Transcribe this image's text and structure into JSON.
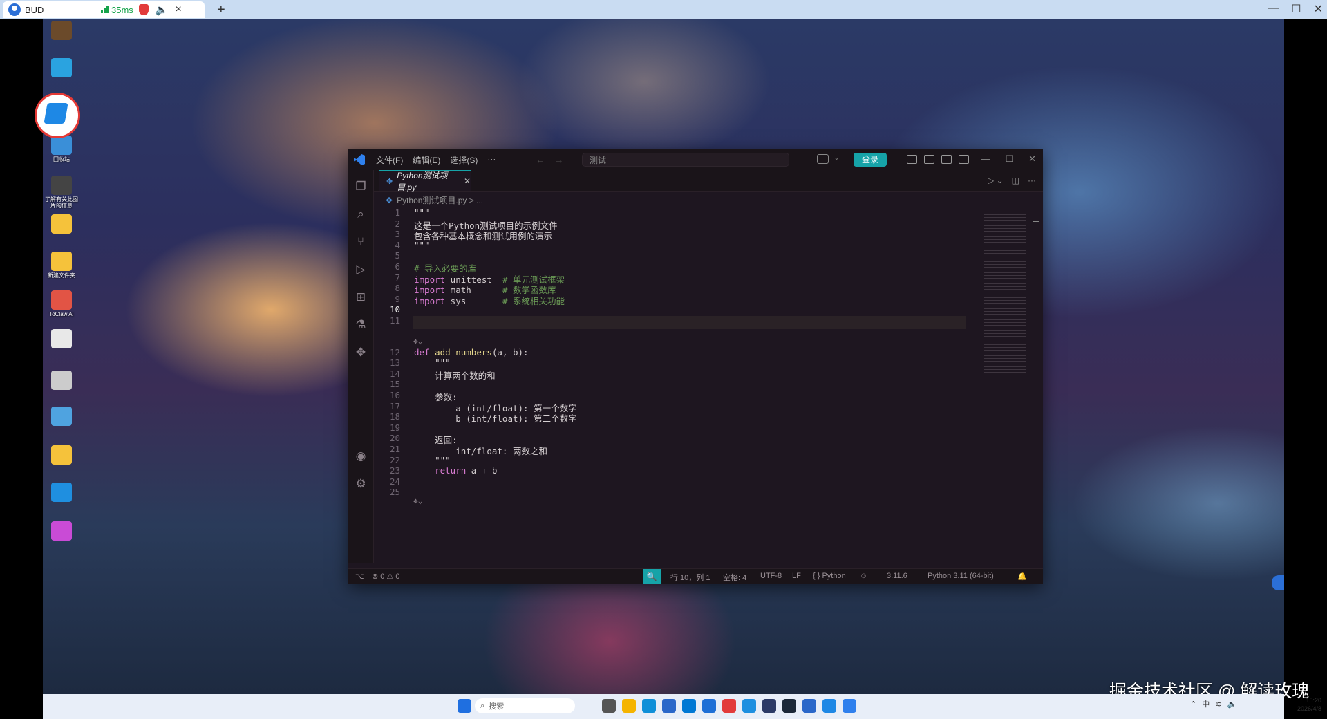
{
  "remote": {
    "tab_name": "BUD",
    "ping": "35ms",
    "close_glyph": "×",
    "new_tab_glyph": "+",
    "win_min": "—",
    "win_max": "☐",
    "win_close": "✕"
  },
  "desktop": {
    "icons": [
      {
        "label": "",
        "icon": "app-icon",
        "color": "#6b4a2a"
      },
      {
        "label": "",
        "icon": "window-icon",
        "color": "#2aa3e0"
      },
      {
        "label": "回收站",
        "icon": "recycle-bin-icon",
        "color": "#3a8fd8"
      },
      {
        "label": "了解有关此图片的信息",
        "icon": "info-icon",
        "color": "#444444"
      },
      {
        "label": "",
        "icon": "folder-icon",
        "color": "#f5c23b"
      },
      {
        "label": "新建文件夹",
        "icon": "folder-icon",
        "color": "#f5c23b"
      },
      {
        "label": "ToClaw AI",
        "icon": "crab-icon",
        "color": "#e25445"
      },
      {
        "label": "",
        "icon": "document-icon",
        "color": "#e8e8e8"
      },
      {
        "label": "",
        "icon": "laptop-icon",
        "color": "#cccccc"
      },
      {
        "label": "",
        "icon": "folder-icon",
        "color": "#4fa3e0"
      },
      {
        "label": "",
        "icon": "folder-icon",
        "color": "#f5c23b"
      },
      {
        "label": "",
        "icon": "edge-icon",
        "color": "#1f8fe0"
      },
      {
        "label": "",
        "icon": "app-icon",
        "color": "#c94bd6"
      }
    ],
    "watermark": "掘金技术社区 @ 解读玫瑰"
  },
  "taskbar": {
    "search_label": "搜索",
    "tray_ime": "中",
    "clock_time": "15:20",
    "clock_date": "2026/4/8",
    "app_colors": [
      "#1f6fe0",
      "#555555",
      "#f5b400",
      "#0f8fd8",
      "#2a67c9",
      "#0078d4",
      "#1e6fd6",
      "#e23b3b",
      "#1d8fe0",
      "#2b3a66",
      "#1b2838",
      "#2a67c9",
      "#1e88e5",
      "#2f80ed"
    ]
  },
  "vscode": {
    "menu": [
      "文件(F)",
      "编辑(E)",
      "选择(S)",
      "···"
    ],
    "nav_back": "←",
    "nav_forward": "→",
    "command_center": "测试",
    "login": "登录",
    "window_min": "—",
    "window_max": "☐",
    "window_close": "✕",
    "tab_icon": "✥",
    "tab_label": "Python测试项目.py",
    "tab_close": "✕",
    "run_glyph": "▷ ⌄",
    "split_glyph": "◫",
    "more_glyph": "···",
    "breadcrumb": "Python测试项目.py > ...",
    "code_lines": [
      {
        "n": "1",
        "html": "\"\"\""
      },
      {
        "n": "2",
        "html": "这是一个Python测试项目的示例文件"
      },
      {
        "n": "3",
        "html": "包含各种基本概念和测试用例的演示"
      },
      {
        "n": "4",
        "html": "\"\"\""
      },
      {
        "n": "5",
        "html": ""
      },
      {
        "n": "6",
        "html": "# 导入必要的库"
      },
      {
        "n": "7",
        "html": "import unittest  # 单元测试框架"
      },
      {
        "n": "8",
        "html": "import math      # 数学函数库"
      },
      {
        "n": "9",
        "html": "import sys       # 系统相关功能"
      },
      {
        "n": "10",
        "html": ""
      },
      {
        "n": "11",
        "html": ""
      },
      {
        "n": "12",
        "html": "def add_numbers(a, b):"
      },
      {
        "n": "13",
        "html": "    \"\"\""
      },
      {
        "n": "14",
        "html": "    计算两个数的和"
      },
      {
        "n": "15",
        "html": ""
      },
      {
        "n": "16",
        "html": "    参数:"
      },
      {
        "n": "17",
        "html": "        a (int/float): 第一个数字"
      },
      {
        "n": "18",
        "html": "        b (int/float): 第二个数字"
      },
      {
        "n": "19",
        "html": ""
      },
      {
        "n": "20",
        "html": "    返回:"
      },
      {
        "n": "21",
        "html": "        int/float: 两数之和"
      },
      {
        "n": "22",
        "html": "    \"\"\""
      },
      {
        "n": "23",
        "html": "    return a + b"
      },
      {
        "n": "24",
        "html": ""
      },
      {
        "n": "25",
        "html": ""
      }
    ],
    "current_line": "10",
    "gutter_hint": "✥⌄",
    "status": {
      "remote": "⌥",
      "errors": "⊗ 0 ⚠ 0",
      "zoom_icon": "🔍",
      "position": "行 10，列 1",
      "spaces": "空格: 4",
      "encoding": "UTF-8",
      "eol": "LF",
      "language": "{ } Python",
      "copilot": "☺",
      "version": "3.11.6",
      "interpreter": "Python 3.11 (64-bit)",
      "bell": "🔔"
    }
  }
}
